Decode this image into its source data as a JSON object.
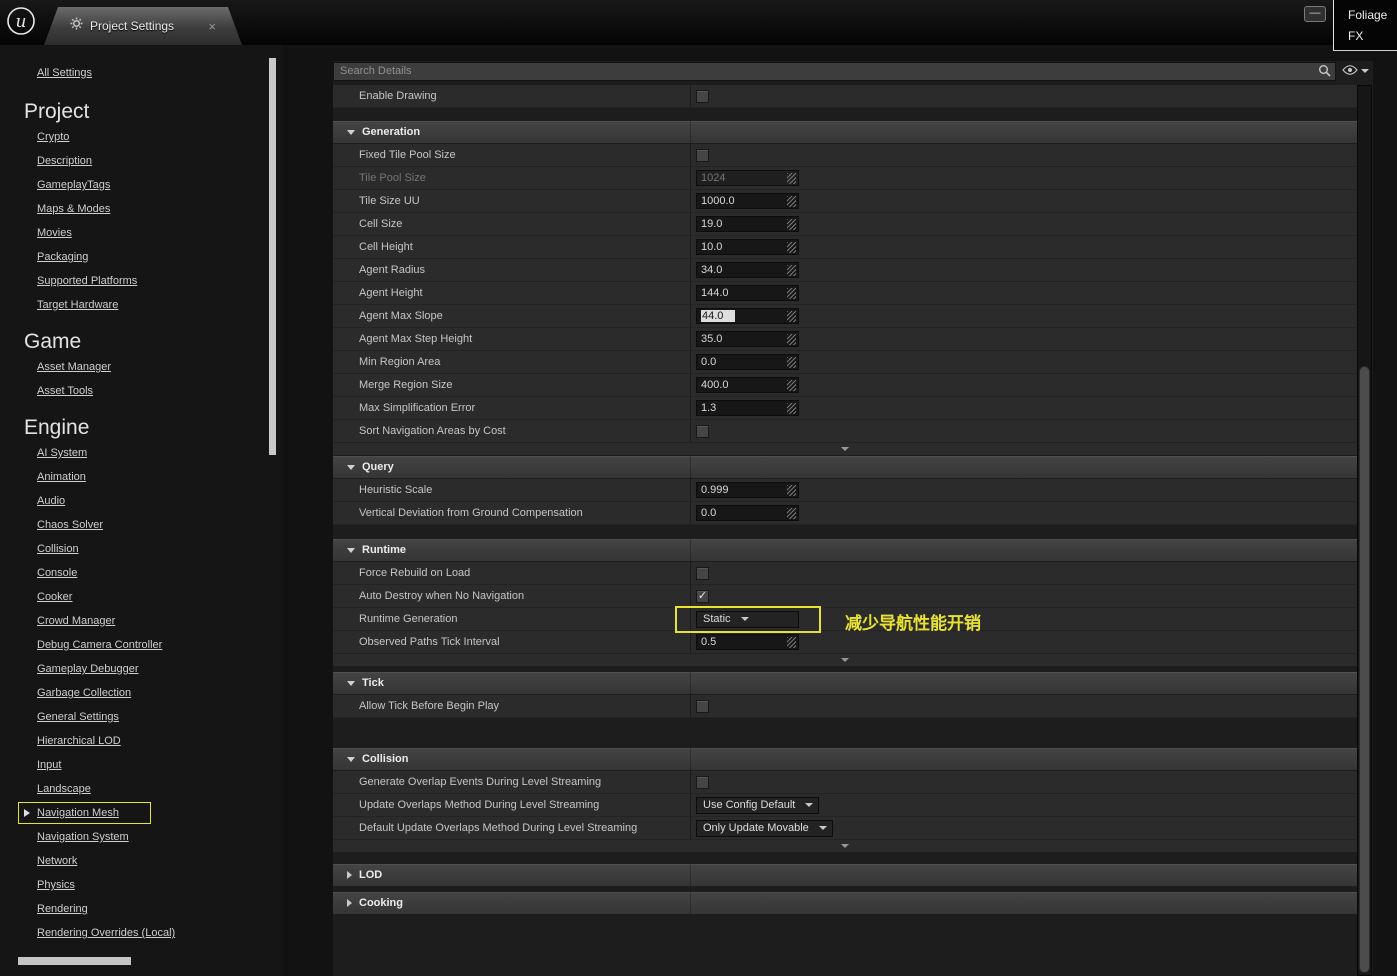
{
  "window": {
    "tab": {
      "title": "Project Settings",
      "close_glyph": "×"
    },
    "minimize_glyph": "—",
    "overlay_menu": {
      "items": [
        "Foliage",
        "FX"
      ]
    }
  },
  "icons": {
    "check": "✓"
  },
  "colors": {
    "highlight_yellow": "#e9e32b",
    "annotation_yellow": "#e8e234"
  },
  "sidebar": {
    "all_settings_label": "All Settings",
    "selected_item": "Navigation Mesh",
    "sections": [
      {
        "title": "Project",
        "items": [
          "Crypto",
          "Description",
          "GameplayTags",
          "Maps & Modes",
          "Movies",
          "Packaging",
          "Supported Platforms",
          "Target Hardware"
        ]
      },
      {
        "title": "Game",
        "items": [
          "Asset Manager",
          "Asset Tools"
        ]
      },
      {
        "title": "Engine",
        "items": [
          "AI System",
          "Animation",
          "Audio",
          "Chaos Solver",
          "Collision",
          "Console",
          "Cooker",
          "Crowd Manager",
          "Debug Camera Controller",
          "Gameplay Debugger",
          "Garbage Collection",
          "General Settings",
          "Hierarchical LOD",
          "Input",
          "Landscape",
          "Navigation Mesh",
          "Navigation System",
          "Network",
          "Physics",
          "Rendering",
          "Rendering Overrides (Local)"
        ]
      }
    ]
  },
  "main": {
    "search": {
      "placeholder": "Search Details"
    },
    "rows": [
      {
        "kind": "prop",
        "label": "Enable Drawing",
        "control": {
          "type": "checkbox",
          "checked": false
        }
      },
      {
        "kind": "gap",
        "size": 13
      },
      {
        "kind": "section",
        "label": "Generation",
        "expanded": true
      },
      {
        "kind": "prop",
        "label": "Fixed Tile Pool Size",
        "control": {
          "type": "checkbox",
          "checked": false
        }
      },
      {
        "kind": "prop",
        "label": "Tile Pool Size",
        "disabled": true,
        "control": {
          "type": "number",
          "value": "1024",
          "disabled": true
        }
      },
      {
        "kind": "prop",
        "label": "Tile Size UU",
        "control": {
          "type": "number",
          "value": "1000.0"
        }
      },
      {
        "kind": "prop",
        "label": "Cell Size",
        "control": {
          "type": "number",
          "value": "19.0"
        }
      },
      {
        "kind": "prop",
        "label": "Cell Height",
        "control": {
          "type": "number",
          "value": "10.0"
        }
      },
      {
        "kind": "prop",
        "label": "Agent Radius",
        "control": {
          "type": "number",
          "value": "34.0"
        }
      },
      {
        "kind": "prop",
        "label": "Agent Height",
        "control": {
          "type": "number",
          "value": "144.0"
        }
      },
      {
        "kind": "prop",
        "label": "Agent Max Slope",
        "control": {
          "type": "number",
          "value": "44.0",
          "selected": true
        }
      },
      {
        "kind": "prop",
        "label": "Agent Max Step Height",
        "control": {
          "type": "number",
          "value": "35.0"
        }
      },
      {
        "kind": "prop",
        "label": "Min Region Area",
        "control": {
          "type": "number",
          "value": "0.0"
        }
      },
      {
        "kind": "prop",
        "label": "Merge Region Size",
        "control": {
          "type": "number",
          "value": "400.0"
        }
      },
      {
        "kind": "prop",
        "label": "Max Simplification Error",
        "control": {
          "type": "number",
          "value": "1.3"
        }
      },
      {
        "kind": "prop",
        "label": "Sort Navigation Areas by Cost",
        "control": {
          "type": "checkbox",
          "checked": false
        }
      },
      {
        "kind": "expander"
      },
      {
        "kind": "section",
        "label": "Query",
        "expanded": true
      },
      {
        "kind": "prop",
        "label": "Heuristic Scale",
        "control": {
          "type": "number",
          "value": "0.999"
        }
      },
      {
        "kind": "prop",
        "label": "Vertical Deviation from Ground Compensation",
        "control": {
          "type": "number",
          "value": "0.0"
        }
      },
      {
        "kind": "gap",
        "size": 14
      },
      {
        "kind": "section",
        "label": "Runtime",
        "expanded": true
      },
      {
        "kind": "prop",
        "label": "Force Rebuild on Load",
        "control": {
          "type": "checkbox",
          "checked": false
        }
      },
      {
        "kind": "prop",
        "label": "Auto Destroy when No Navigation",
        "control": {
          "type": "checkbox",
          "checked": true
        }
      },
      {
        "kind": "prop",
        "label": "Runtime Generation",
        "control": {
          "type": "dropdown",
          "value": "Static",
          "highlighted": true
        },
        "annotation": "减少导航性能开销"
      },
      {
        "kind": "prop",
        "label": "Observed Paths Tick Interval",
        "control": {
          "type": "number",
          "value": "0.5"
        }
      },
      {
        "kind": "expander"
      },
      {
        "kind": "gap",
        "size": 5
      },
      {
        "kind": "section",
        "label": "Tick",
        "expanded": true
      },
      {
        "kind": "prop",
        "label": "Allow Tick Before Begin Play",
        "control": {
          "type": "checkbox",
          "checked": false
        }
      },
      {
        "kind": "gap",
        "size": 30
      },
      {
        "kind": "section",
        "label": "Collision",
        "expanded": true
      },
      {
        "kind": "prop",
        "label": "Generate Overlap Events During Level Streaming",
        "control": {
          "type": "checkbox",
          "checked": false
        }
      },
      {
        "kind": "prop",
        "label": "Update Overlaps Method During Level Streaming",
        "control": {
          "type": "dropdown",
          "value": "Use Config Default"
        }
      },
      {
        "kind": "prop",
        "label": "Default Update Overlaps Method During Level Streaming",
        "control": {
          "type": "dropdown",
          "value": "Only Update Movable"
        }
      },
      {
        "kind": "expander"
      },
      {
        "kind": "gap",
        "size": 11
      },
      {
        "kind": "section",
        "label": "LOD",
        "expanded": false
      },
      {
        "kind": "gap",
        "size": 5
      },
      {
        "kind": "section",
        "label": "Cooking",
        "expanded": false
      }
    ]
  }
}
